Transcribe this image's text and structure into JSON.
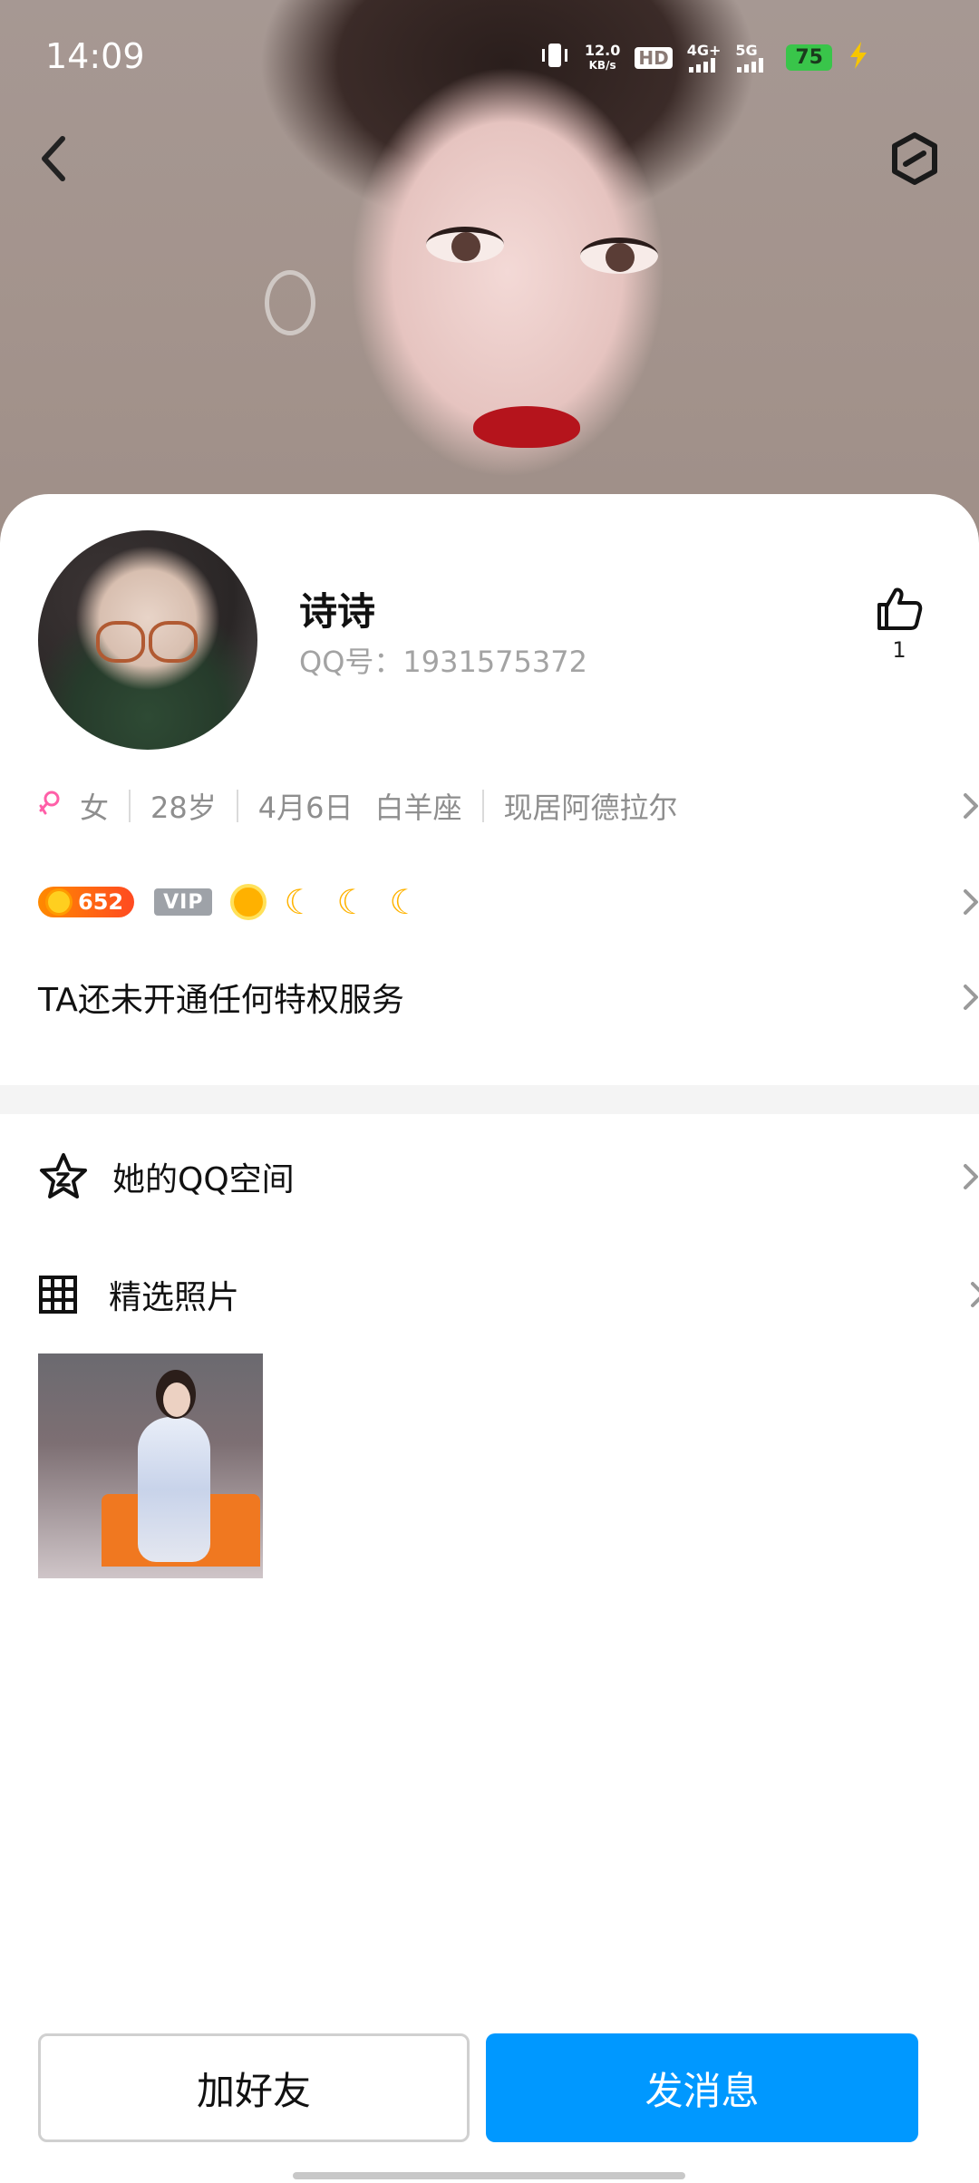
{
  "status_bar": {
    "time": "14:09",
    "net_speed": "12.0",
    "net_speed_unit": "KB/s",
    "hd_label": "HD",
    "network_4g": "4G+",
    "network_5g": "5G",
    "battery": "75",
    "icons": [
      "vibrate-icon",
      "hd-icon",
      "signal-icon",
      "signal-5g-icon",
      "battery-icon",
      "charging-icon"
    ]
  },
  "header": {
    "back_icon": "chevron-left-icon",
    "settings_icon": "hexagon-settings-icon"
  },
  "profile": {
    "name": "诗诗",
    "qq_number": "QQ号：1931575372",
    "like_count": "1"
  },
  "info": {
    "gender": "女",
    "age": "28岁",
    "birthday": "4月6日",
    "zodiac": "白羊座",
    "location": "现居阿德拉尔"
  },
  "badges": {
    "level": "652",
    "vip": "VIP"
  },
  "privilege": "TA还未开通任何特权服务",
  "menu": {
    "qzone": "她的QQ空间",
    "photos": "精选照片"
  },
  "actions": {
    "add_friend": "加好友",
    "send_message": "发消息"
  },
  "colors": {
    "accent": "#0098ff",
    "gender_female": "#ff5fa8",
    "battery": "#39c54a"
  }
}
